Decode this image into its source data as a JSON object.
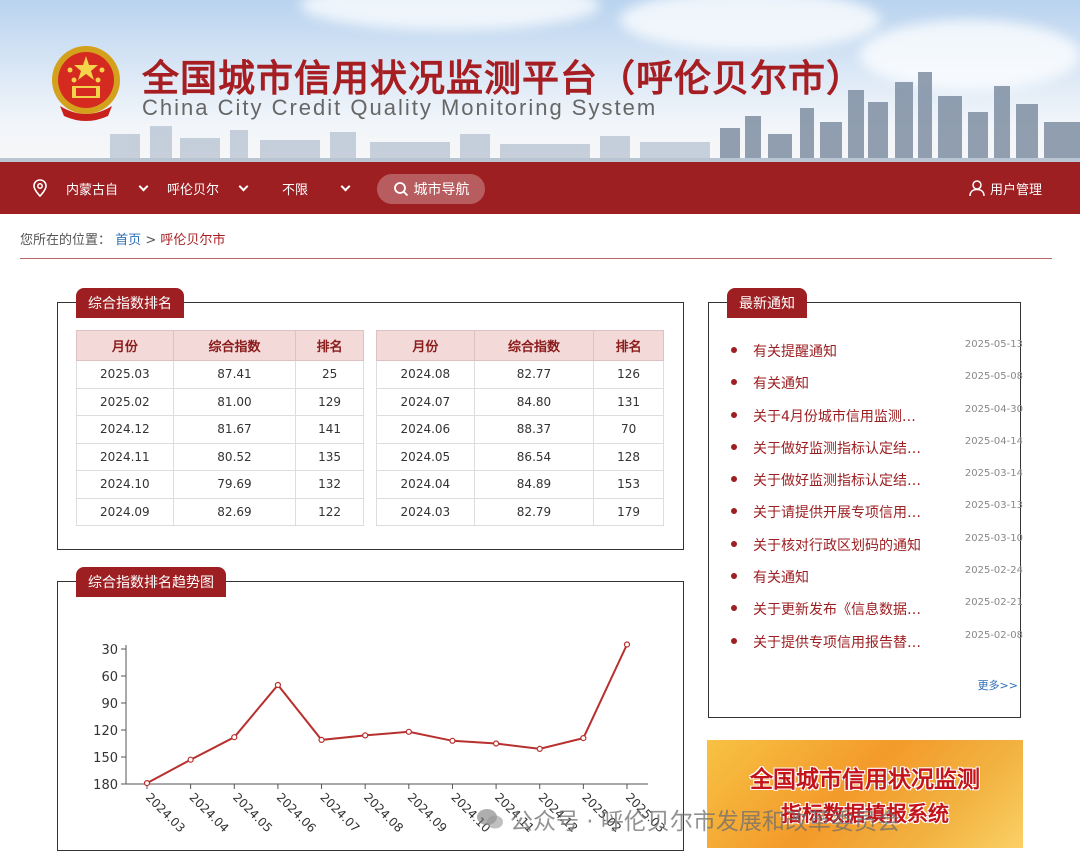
{
  "header": {
    "title_cn": "全国城市信用状况监测平台（呼伦贝尔市）",
    "title_en": "China City Credit Quality Monitoring System"
  },
  "nav": {
    "province": "内蒙古自",
    "city": "呼伦贝尔",
    "county": "不限",
    "city_nav": "城市导航",
    "user_manage": "用户管理"
  },
  "breadcrumb": {
    "prefix": "您所在的位置：",
    "home": "首页",
    "sep": ">",
    "current": "呼伦贝尔市"
  },
  "ranking": {
    "tab": "综合指数排名",
    "headers": [
      "月份",
      "综合指数",
      "排名"
    ],
    "left_rows": [
      [
        "2025.03",
        "87.41",
        "25"
      ],
      [
        "2025.02",
        "81.00",
        "129"
      ],
      [
        "2024.12",
        "81.67",
        "141"
      ],
      [
        "2024.11",
        "80.52",
        "135"
      ],
      [
        "2024.10",
        "79.69",
        "132"
      ],
      [
        "2024.09",
        "82.69",
        "122"
      ]
    ],
    "right_rows": [
      [
        "2024.08",
        "82.77",
        "126"
      ],
      [
        "2024.07",
        "84.80",
        "131"
      ],
      [
        "2024.06",
        "88.37",
        "70"
      ],
      [
        "2024.05",
        "86.54",
        "128"
      ],
      [
        "2024.04",
        "84.89",
        "153"
      ],
      [
        "2024.03",
        "82.79",
        "179"
      ]
    ]
  },
  "trend": {
    "tab": "综合指数排名趋势图"
  },
  "chart_data": {
    "type": "line",
    "x": [
      "2024.03",
      "2024.04",
      "2024.05",
      "2024.06",
      "2024.07",
      "2024.08",
      "2024.09",
      "2024.10",
      "2024.11",
      "2024.12",
      "2025.02",
      "2025.03"
    ],
    "series": [
      {
        "values": [
          179,
          153,
          128,
          70,
          131,
          126,
          122,
          132,
          135,
          141,
          129,
          25
        ],
        "color": "#b8302e"
      }
    ],
    "y_ticks": [
      30,
      60,
      90,
      120,
      150,
      180
    ],
    "ylim": [
      180,
      30
    ],
    "y_inverted": true,
    "grid": false
  },
  "notices": {
    "tab": "最新通知",
    "items": [
      {
        "title": "有关提醒通知",
        "date": "2025-05-13"
      },
      {
        "title": "有关通知",
        "date": "2025-05-08"
      },
      {
        "title": "关于4月份城市信用监测…",
        "date": "2025-04-30"
      },
      {
        "title": "关于做好监测指标认定结…",
        "date": "2025-04-14"
      },
      {
        "title": "关于做好监测指标认定结…",
        "date": "2025-03-14"
      },
      {
        "title": "关于请提供开展专项信用…",
        "date": "2025-03-13"
      },
      {
        "title": "关于核对行政区划码的通知",
        "date": "2025-03-10"
      },
      {
        "title": "有关通知",
        "date": "2025-02-24"
      },
      {
        "title": "关于更新发布《信息数据…",
        "date": "2025-02-21"
      },
      {
        "title": "关于提供专项信用报告替…",
        "date": "2025-02-08"
      }
    ],
    "more": "更多>>"
  },
  "promo": {
    "line1": "全国城市信用状况监测",
    "line2": "指标数据填报系统"
  },
  "watermark": "公众号 · 呼伦贝尔市发展和改革委员会",
  "colors": {
    "brand": "#9d1f22",
    "link": "#2d6fb4",
    "table_header": "#f4d9d9"
  }
}
